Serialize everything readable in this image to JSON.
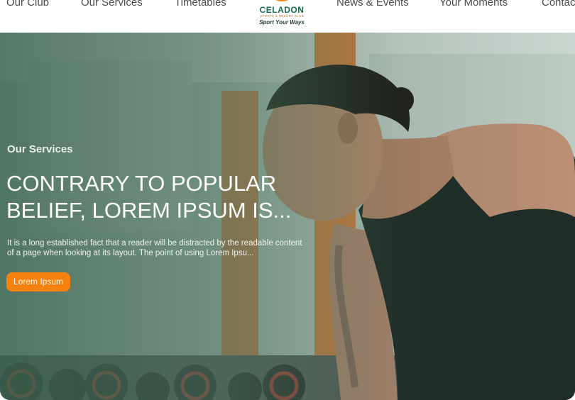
{
  "nav": {
    "items": [
      "Our Club",
      "Our Services",
      "Timetables",
      "News & Events",
      "Your Moments",
      "Contact"
    ],
    "logo": {
      "name": "CELADON",
      "subtitle": "SPORTS & RESORT CLUB",
      "tagline": "Sport Your Ways"
    }
  },
  "hero": {
    "eyebrow": "Our Services",
    "headline": "CONTRARY TO POPULAR BELIEF, LOREM IPSUM IS...",
    "description": "It is a long established fact that a reader will be distracted by the readable content of a page when looking at its layout. The point of using Lorem Ipsu...",
    "cta_label": "Lorem Ipsum"
  },
  "colors": {
    "accent": "#f5820f",
    "brand_green": "#1b6b4a",
    "overlay_green": "#3a624e"
  }
}
